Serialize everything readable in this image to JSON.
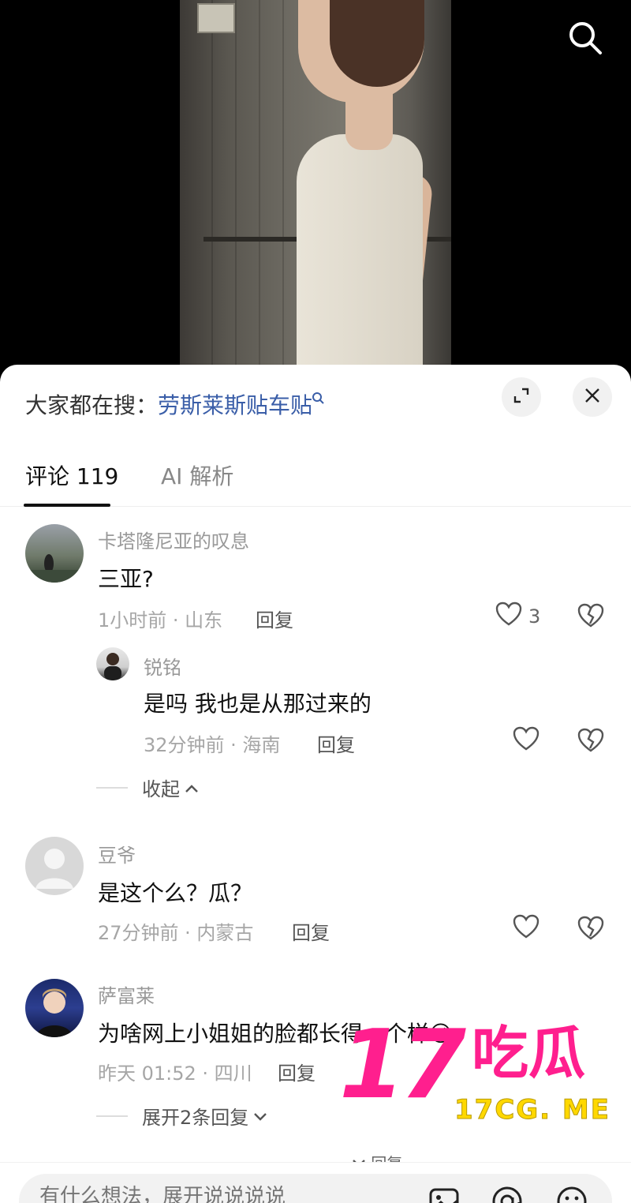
{
  "header": {
    "search_icon": "search-icon"
  },
  "hot_search": {
    "prefix": "大家都在搜：",
    "query": "劳斯莱斯贴车贴",
    "icon": "search-small-icon"
  },
  "tabs": [
    {
      "label": "评论 119"
    },
    {
      "label": "AI 解析"
    }
  ],
  "comments": [
    {
      "username": "卡塔隆尼亚的叹息",
      "text": "三亚?",
      "meta": "1小时前 · 山东",
      "reply_label": "回复",
      "likes": "3",
      "replies": [
        {
          "username": "锐铭",
          "text": "是吗 我也是从那过来的",
          "meta": "32分钟前 · 海南",
          "reply_label": "回复"
        }
      ],
      "fold_label": "收起"
    },
    {
      "username": "豆爷",
      "text": "是这个么？瓜？",
      "meta": "27分钟前 · 内蒙古",
      "reply_label": "回复"
    },
    {
      "username": "萨富莱",
      "text": "为啥网上小姐姐的脸都长得一个样😘",
      "meta": "昨天 01:52 · 四川",
      "reply_label": "回复",
      "expand_label": "展开2条回复"
    }
  ],
  "more_hint": "回复",
  "input": {
    "placeholder": "有什么想法，展开说说说说"
  },
  "watermark": {
    "big": "17",
    "cn": "吃瓜",
    "url": "17CG. ME"
  },
  "colors": {
    "accent_link": "#3a5ea8",
    "watermark_pink": "#ff1f8e",
    "watermark_yellow": "#ffd800"
  }
}
